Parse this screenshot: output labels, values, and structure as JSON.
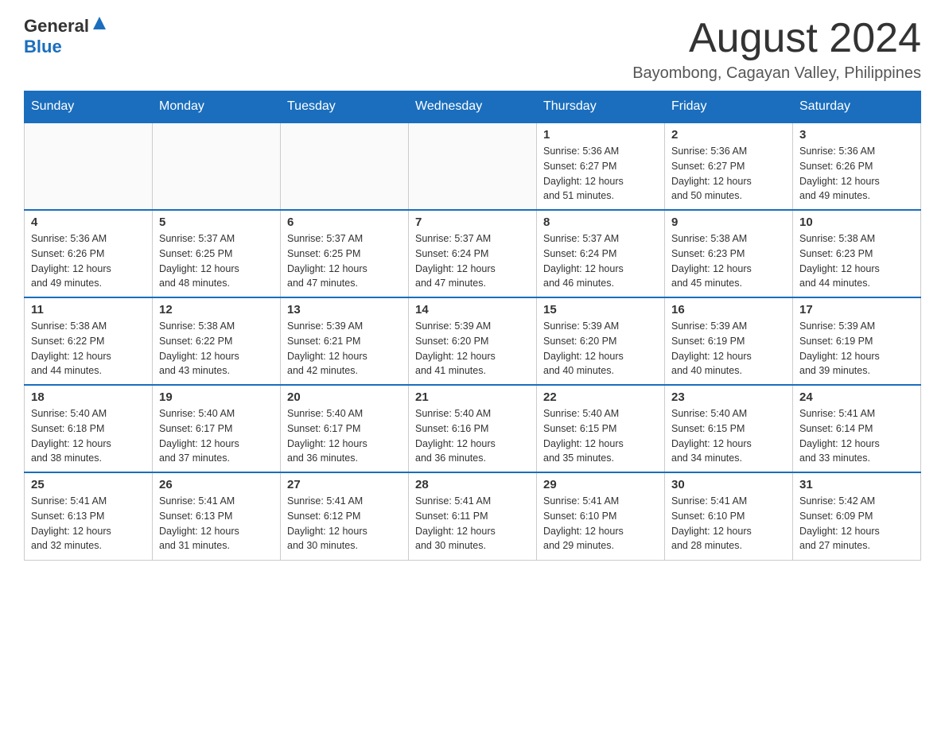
{
  "header": {
    "logo_general": "General",
    "logo_blue": "Blue",
    "month_title": "August 2024",
    "location": "Bayombong, Cagayan Valley, Philippines"
  },
  "days_of_week": [
    "Sunday",
    "Monday",
    "Tuesday",
    "Wednesday",
    "Thursday",
    "Friday",
    "Saturday"
  ],
  "weeks": [
    [
      {
        "day": "",
        "info": ""
      },
      {
        "day": "",
        "info": ""
      },
      {
        "day": "",
        "info": ""
      },
      {
        "day": "",
        "info": ""
      },
      {
        "day": "1",
        "info": "Sunrise: 5:36 AM\nSunset: 6:27 PM\nDaylight: 12 hours\nand 51 minutes."
      },
      {
        "day": "2",
        "info": "Sunrise: 5:36 AM\nSunset: 6:27 PM\nDaylight: 12 hours\nand 50 minutes."
      },
      {
        "day": "3",
        "info": "Sunrise: 5:36 AM\nSunset: 6:26 PM\nDaylight: 12 hours\nand 49 minutes."
      }
    ],
    [
      {
        "day": "4",
        "info": "Sunrise: 5:36 AM\nSunset: 6:26 PM\nDaylight: 12 hours\nand 49 minutes."
      },
      {
        "day": "5",
        "info": "Sunrise: 5:37 AM\nSunset: 6:25 PM\nDaylight: 12 hours\nand 48 minutes."
      },
      {
        "day": "6",
        "info": "Sunrise: 5:37 AM\nSunset: 6:25 PM\nDaylight: 12 hours\nand 47 minutes."
      },
      {
        "day": "7",
        "info": "Sunrise: 5:37 AM\nSunset: 6:24 PM\nDaylight: 12 hours\nand 47 minutes."
      },
      {
        "day": "8",
        "info": "Sunrise: 5:37 AM\nSunset: 6:24 PM\nDaylight: 12 hours\nand 46 minutes."
      },
      {
        "day": "9",
        "info": "Sunrise: 5:38 AM\nSunset: 6:23 PM\nDaylight: 12 hours\nand 45 minutes."
      },
      {
        "day": "10",
        "info": "Sunrise: 5:38 AM\nSunset: 6:23 PM\nDaylight: 12 hours\nand 44 minutes."
      }
    ],
    [
      {
        "day": "11",
        "info": "Sunrise: 5:38 AM\nSunset: 6:22 PM\nDaylight: 12 hours\nand 44 minutes."
      },
      {
        "day": "12",
        "info": "Sunrise: 5:38 AM\nSunset: 6:22 PM\nDaylight: 12 hours\nand 43 minutes."
      },
      {
        "day": "13",
        "info": "Sunrise: 5:39 AM\nSunset: 6:21 PM\nDaylight: 12 hours\nand 42 minutes."
      },
      {
        "day": "14",
        "info": "Sunrise: 5:39 AM\nSunset: 6:20 PM\nDaylight: 12 hours\nand 41 minutes."
      },
      {
        "day": "15",
        "info": "Sunrise: 5:39 AM\nSunset: 6:20 PM\nDaylight: 12 hours\nand 40 minutes."
      },
      {
        "day": "16",
        "info": "Sunrise: 5:39 AM\nSunset: 6:19 PM\nDaylight: 12 hours\nand 40 minutes."
      },
      {
        "day": "17",
        "info": "Sunrise: 5:39 AM\nSunset: 6:19 PM\nDaylight: 12 hours\nand 39 minutes."
      }
    ],
    [
      {
        "day": "18",
        "info": "Sunrise: 5:40 AM\nSunset: 6:18 PM\nDaylight: 12 hours\nand 38 minutes."
      },
      {
        "day": "19",
        "info": "Sunrise: 5:40 AM\nSunset: 6:17 PM\nDaylight: 12 hours\nand 37 minutes."
      },
      {
        "day": "20",
        "info": "Sunrise: 5:40 AM\nSunset: 6:17 PM\nDaylight: 12 hours\nand 36 minutes."
      },
      {
        "day": "21",
        "info": "Sunrise: 5:40 AM\nSunset: 6:16 PM\nDaylight: 12 hours\nand 36 minutes."
      },
      {
        "day": "22",
        "info": "Sunrise: 5:40 AM\nSunset: 6:15 PM\nDaylight: 12 hours\nand 35 minutes."
      },
      {
        "day": "23",
        "info": "Sunrise: 5:40 AM\nSunset: 6:15 PM\nDaylight: 12 hours\nand 34 minutes."
      },
      {
        "day": "24",
        "info": "Sunrise: 5:41 AM\nSunset: 6:14 PM\nDaylight: 12 hours\nand 33 minutes."
      }
    ],
    [
      {
        "day": "25",
        "info": "Sunrise: 5:41 AM\nSunset: 6:13 PM\nDaylight: 12 hours\nand 32 minutes."
      },
      {
        "day": "26",
        "info": "Sunrise: 5:41 AM\nSunset: 6:13 PM\nDaylight: 12 hours\nand 31 minutes."
      },
      {
        "day": "27",
        "info": "Sunrise: 5:41 AM\nSunset: 6:12 PM\nDaylight: 12 hours\nand 30 minutes."
      },
      {
        "day": "28",
        "info": "Sunrise: 5:41 AM\nSunset: 6:11 PM\nDaylight: 12 hours\nand 30 minutes."
      },
      {
        "day": "29",
        "info": "Sunrise: 5:41 AM\nSunset: 6:10 PM\nDaylight: 12 hours\nand 29 minutes."
      },
      {
        "day": "30",
        "info": "Sunrise: 5:41 AM\nSunset: 6:10 PM\nDaylight: 12 hours\nand 28 minutes."
      },
      {
        "day": "31",
        "info": "Sunrise: 5:42 AM\nSunset: 6:09 PM\nDaylight: 12 hours\nand 27 minutes."
      }
    ]
  ]
}
